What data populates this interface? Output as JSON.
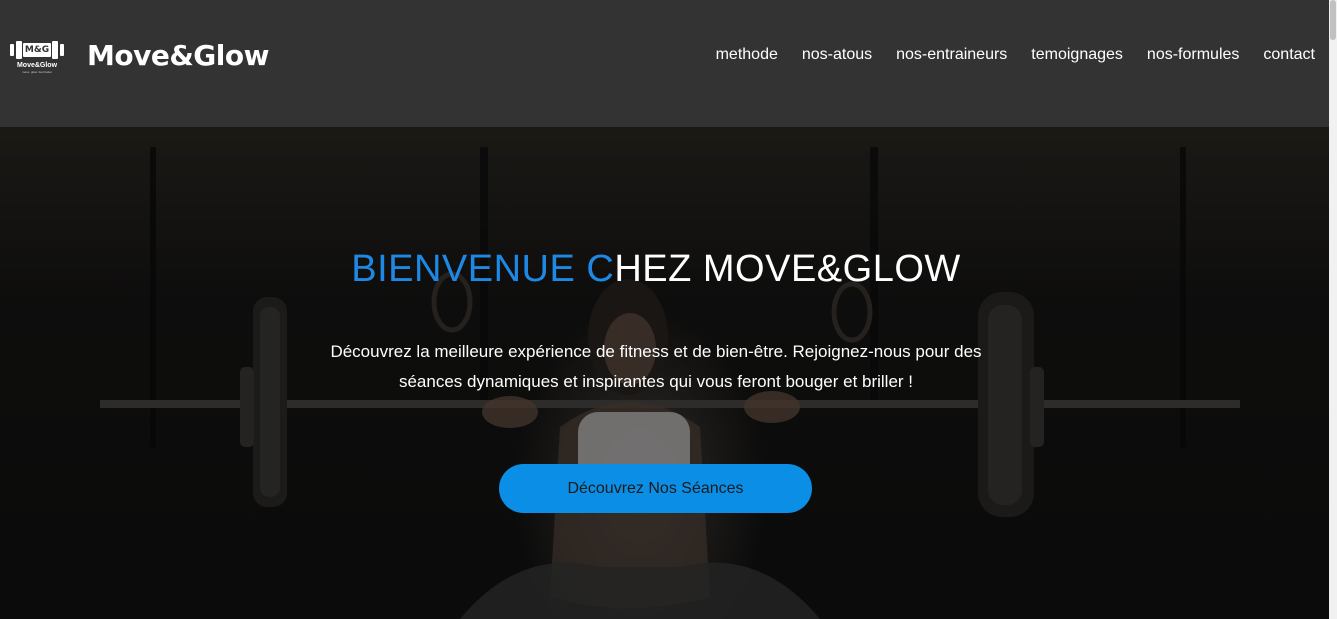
{
  "header": {
    "logo": {
      "monogram": "M&G",
      "name": "Move&Glow",
      "tagline": "move. glow. feel better"
    },
    "brand_title": "Move&Glow",
    "nav": [
      {
        "label": "methode"
      },
      {
        "label": "nos-atous"
      },
      {
        "label": "nos-entraineurs"
      },
      {
        "label": "temoignages"
      },
      {
        "label": "nos-formules"
      },
      {
        "label": "contact"
      }
    ]
  },
  "hero": {
    "title_accent": "BIENVENUE C",
    "title_rest": "HEZ MOVE&GLOW",
    "subtitle": "Découvrez la meilleure expérience de fitness et de bien-être. Rejoignez-nous pour des séances dynamiques et inspirantes qui vous feront bouger et briller !",
    "cta_label": "Découvrez Nos Séances"
  },
  "colors": {
    "navbar_bg": "#333333",
    "accent": "#1e88e5",
    "button_bg": "#0b8ee6",
    "text": "#ffffff"
  }
}
